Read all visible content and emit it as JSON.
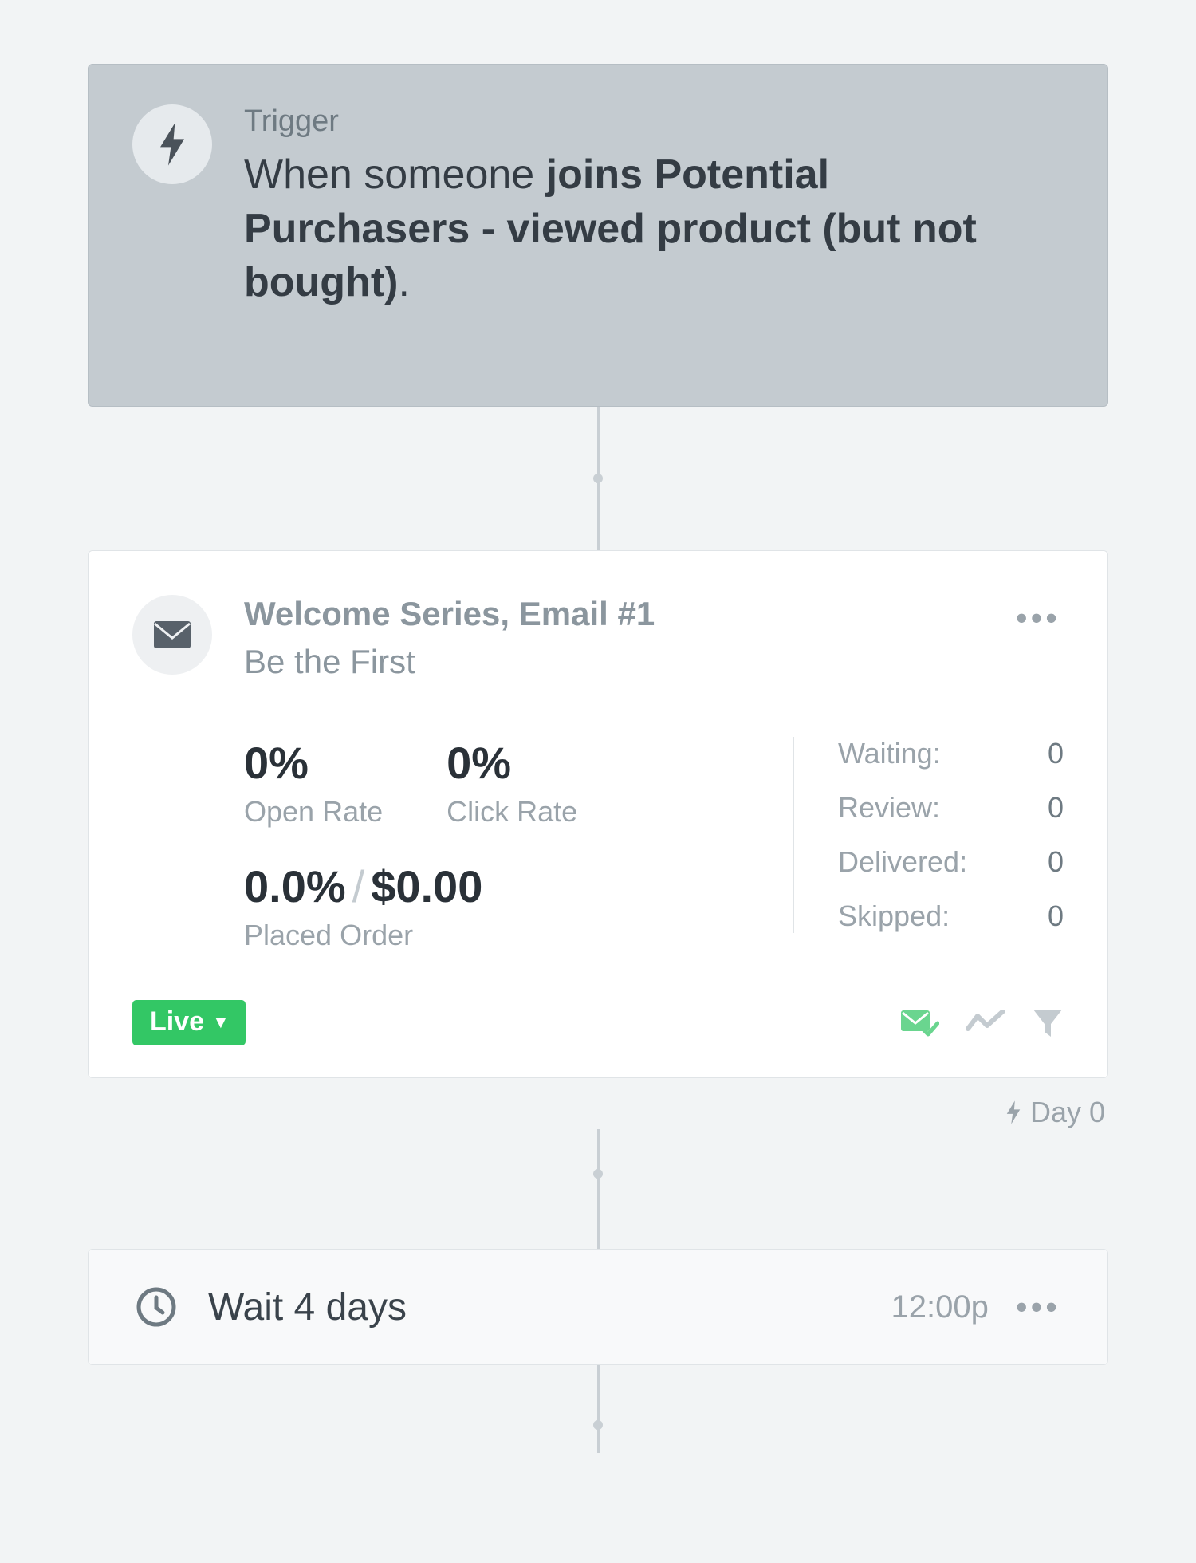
{
  "trigger": {
    "label": "Trigger",
    "prefix": "When someone ",
    "bold_segment": "joins Potential Purchasers - viewed product (but not bought)",
    "suffix": "."
  },
  "email": {
    "title": "Welcome Series, Email #1",
    "subtitle": "Be the First",
    "open_rate_value": "0%",
    "open_rate_label": "Open Rate",
    "click_rate_value": "0%",
    "click_rate_label": "Click Rate",
    "placed_order_pct": "0.0%",
    "placed_order_amount": "$0.00",
    "placed_order_label": "Placed Order",
    "counts": {
      "waiting_label": "Waiting:",
      "waiting_value": "0",
      "review_label": "Review:",
      "review_value": "0",
      "delivered_label": "Delivered:",
      "delivered_value": "0",
      "skipped_label": "Skipped:",
      "skipped_value": "0"
    },
    "status_label": "Live",
    "day_label": "Day 0"
  },
  "wait": {
    "text": "Wait 4 days",
    "time": "12:00p"
  }
}
